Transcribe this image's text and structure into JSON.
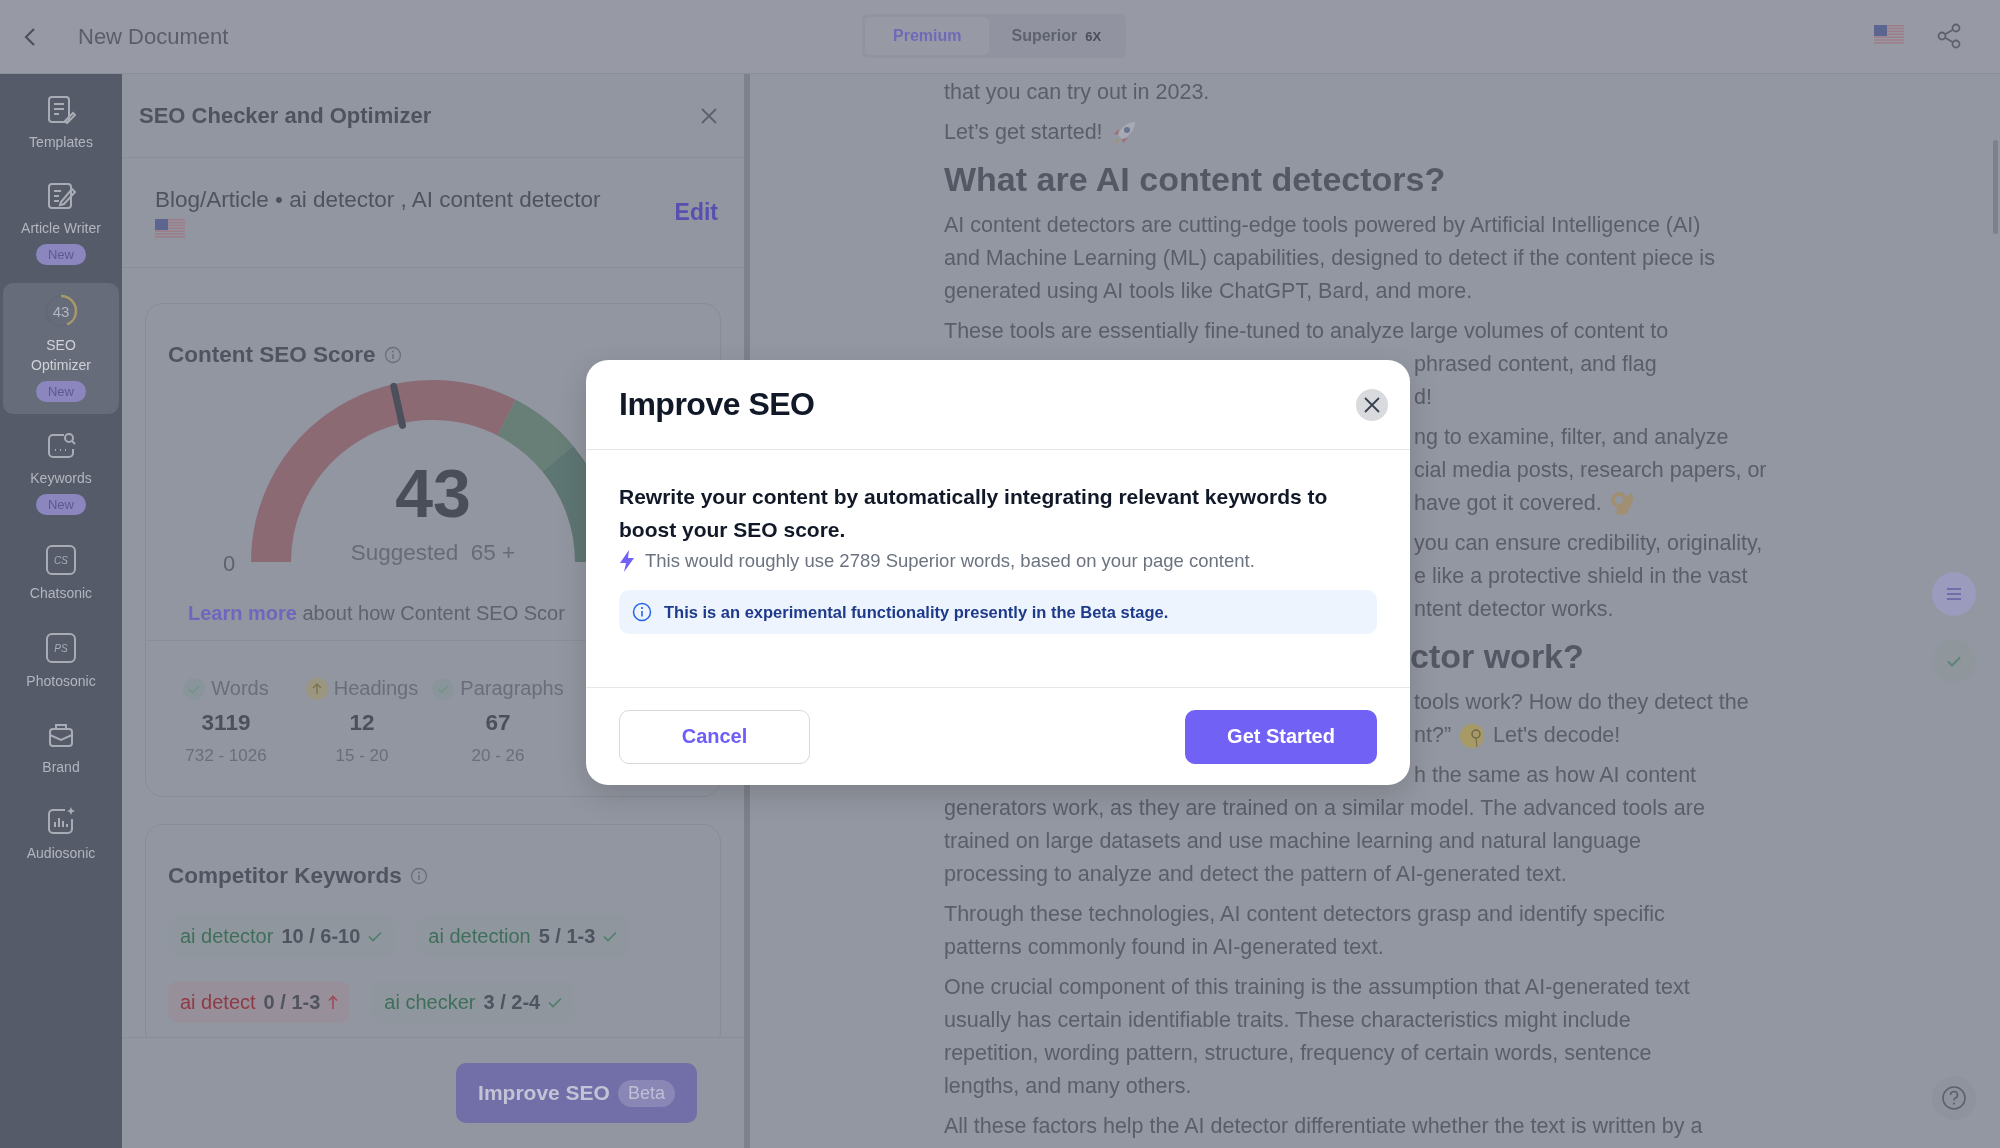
{
  "top_bar": {
    "title": "New Document",
    "plan_tabs": [
      {
        "label": "Premium",
        "selected": true
      },
      {
        "label": "Superior",
        "badge": "6X",
        "selected": false
      }
    ]
  },
  "sidebar": {
    "items": [
      {
        "kind": "templates",
        "label": "Templates",
        "selected": false
      },
      {
        "kind": "writer",
        "label": "Article Writer",
        "badge": "New",
        "selected": false
      },
      {
        "kind": "score",
        "score": "43",
        "level": 0.43,
        "label": "SEO Optimizer",
        "badge": "New",
        "selected": true
      },
      {
        "kind": "keywords",
        "label": "Keywords",
        "badge": "New",
        "selected": false
      },
      {
        "kind": "boxed",
        "icon_text": "CS",
        "label": "Chatsonic",
        "selected": false
      },
      {
        "kind": "boxed",
        "icon_text": "PS",
        "label": "Photosonic",
        "selected": false
      },
      {
        "kind": "brand",
        "label": "Brand",
        "selected": false
      },
      {
        "kind": "audio",
        "label": "Audiosonic",
        "selected": false
      }
    ]
  },
  "seo_panel": {
    "title": "SEO Checker and Optimizer",
    "summary": "Blog/Article • ai detector , AI content detector",
    "edit": "Edit",
    "score_card": {
      "title": "Content SEO Score",
      "score": "43",
      "level": 0.43,
      "min": "0",
      "suggested_label": "Suggested",
      "suggested": "65 +",
      "link": "Learn more",
      "link_rest": "about how Content SEO Scor",
      "stats": [
        {
          "label": "Words",
          "value": "3119",
          "range": "732 - 1026",
          "kind": "ok"
        },
        {
          "label": "Headings",
          "value": "12",
          "range": "15 - 20",
          "kind": "low"
        },
        {
          "label": "Paragraphs",
          "value": "67",
          "range": "20 - 26",
          "kind": "ok"
        }
      ]
    },
    "keywords_card": {
      "title": "Competitor Keywords",
      "chips": [
        {
          "keyword": "ai detector",
          "count": "10 / 6-10",
          "kind": "ok"
        },
        {
          "keyword": "ai detection",
          "count": "5 / 1-3",
          "kind": "ok"
        },
        {
          "keyword": "ai detect",
          "count": "0 / 1-3",
          "kind": "low"
        },
        {
          "keyword": "ai checker",
          "count": "3 / 2-4",
          "kind": "ok"
        }
      ]
    },
    "improve_button": {
      "label": "Improve SEO",
      "badge": "Beta"
    }
  },
  "article": {
    "paragraphs": [
      {
        "kind": "text",
        "lines": [
          {
            "text": "that you can try out in 2023.",
            "kind": "plain"
          }
        ]
      },
      {
        "kind": "text",
        "lines": [
          {
            "text": "Let’s get started!",
            "kind": "rocket"
          }
        ]
      },
      {
        "kind": "heading",
        "lines": [
          {
            "text": "What are AI content detectors?",
            "kind": "plain"
          }
        ]
      },
      {
        "kind": "text",
        "lines": [
          {
            "text": "AI content detectors are cutting-edge tools powered by Artificial Intelligence (AI)",
            "kind": "plain"
          },
          {
            "text": "and Machine Learning (ML) capabilities, designed to detect if the content piece is",
            "kind": "plain"
          },
          {
            "text": "generated using AI tools like ChatGPT, Bard, and more.",
            "kind": "plain"
          }
        ]
      },
      {
        "kind": "text",
        "lines": [
          {
            "text": "These tools are essentially fine-tuned to analyze large volumes of content to",
            "kind": "plain"
          },
          {
            "text": "phrased content, and flag",
            "kind": "covered"
          },
          {
            "text": "d!",
            "kind": "covered"
          }
        ]
      },
      {
        "kind": "text",
        "lines": [
          {
            "text": "ng to examine, filter, and analyze",
            "kind": "covered"
          },
          {
            "text": "cial media posts, research papers, or",
            "kind": "covered"
          },
          {
            "text": "have got it covered.",
            "kind": "covered-ok-hand"
          }
        ]
      },
      {
        "kind": "text",
        "lines": [
          {
            "text": "you can ensure credibility, originality,",
            "kind": "covered"
          },
          {
            "text": "e like a protective shield in the vast",
            "kind": "covered"
          },
          {
            "text": "ntent detector works.",
            "kind": "covered"
          }
        ]
      },
      {
        "kind": "heading",
        "lines": [
          {
            "text": "ctor work?",
            "kind": "covered"
          }
        ]
      },
      {
        "kind": "text",
        "lines": [
          {
            "text": "tools work? How do they detect the",
            "kind": "covered"
          },
          {
            "text": "nt?”",
            "kind": "covered-monocle",
            "after": "Let's decode!"
          }
        ]
      },
      {
        "kind": "text",
        "lines": [
          {
            "text": "h the same as how AI content",
            "kind": "covered"
          },
          {
            "text": "generators work, as they are trained on a similar model. The advanced tools are",
            "kind": "plain"
          },
          {
            "text": "trained on large datasets and use machine learning and natural language",
            "kind": "plain"
          },
          {
            "text": "processing to analyze and detect the pattern of AI-generated text.",
            "kind": "plain"
          }
        ]
      },
      {
        "kind": "text",
        "lines": [
          {
            "text": "Through these technologies, AI content detectors grasp and identify specific",
            "kind": "plain"
          },
          {
            "text": "patterns commonly found in AI-generated text.",
            "kind": "plain"
          }
        ]
      },
      {
        "kind": "text",
        "lines": [
          {
            "text": "One crucial component of this training is the assumption that AI-generated text",
            "kind": "plain"
          },
          {
            "text": "usually has certain identifiable traits. These characteristics might include",
            "kind": "plain"
          },
          {
            "text": "repetition, wording pattern, structure, frequency of certain words, sentence",
            "kind": "plain"
          },
          {
            "text": "lengths, and many others.",
            "kind": "plain"
          }
        ]
      },
      {
        "kind": "text",
        "lines": [
          {
            "text": "All these factors help the AI detector differentiate whether the text is written by a",
            "kind": "plain"
          }
        ]
      }
    ]
  },
  "modal": {
    "title": "Improve SEO",
    "lead": "Rewrite your content by automatically integrating relevant keywords to boost your SEO score.",
    "note": "This would roughly use 2789 Superior words, based on your page content.",
    "notice": "This is an experimental functionality presently in the Beta stage.",
    "cancel": "Cancel",
    "confirm": "Get Started"
  }
}
